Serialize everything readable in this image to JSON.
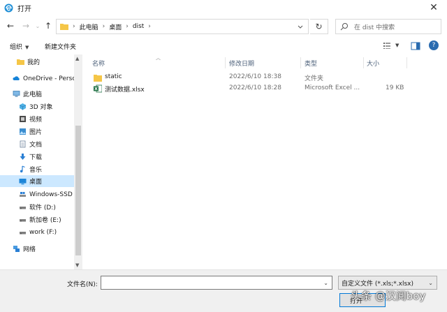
{
  "window": {
    "title": "打开"
  },
  "nav": {
    "breadcrumb": [
      "此电脑",
      "桌面",
      "dist"
    ]
  },
  "search": {
    "placeholder": "在 dist 中搜索"
  },
  "toolbar": {
    "organize_label": "组织",
    "new_folder_label": "新建文件夹"
  },
  "sidebar": {
    "items": [
      {
        "label": "我的",
        "icon": "folder-icon"
      },
      {
        "label": "OneDrive - Perso",
        "icon": "cloud-icon"
      },
      {
        "label": "此电脑",
        "icon": "computer-icon"
      },
      {
        "label": "3D 对象",
        "icon": "cube-icon"
      },
      {
        "label": "视频",
        "icon": "video-icon"
      },
      {
        "label": "图片",
        "icon": "picture-icon"
      },
      {
        "label": "文档",
        "icon": "document-icon"
      },
      {
        "label": "下载",
        "icon": "download-icon"
      },
      {
        "label": "音乐",
        "icon": "music-icon"
      },
      {
        "label": "桌面",
        "icon": "desktop-icon"
      },
      {
        "label": "Windows-SSD",
        "icon": "drive-icon"
      },
      {
        "label": "软件 (D:)",
        "icon": "drive-icon"
      },
      {
        "label": "新加卷 (E:)",
        "icon": "drive-icon"
      },
      {
        "label": "work (F:)",
        "icon": "drive-icon"
      },
      {
        "label": "网络",
        "icon": "network-icon"
      }
    ]
  },
  "columns": {
    "name": "名称",
    "modified": "修改日期",
    "type": "类型",
    "size": "大小"
  },
  "files": [
    {
      "name": "static",
      "modified": "2022/6/10 18:38",
      "type": "文件夹",
      "size": "",
      "icon": "folder-icon"
    },
    {
      "name": "测试数据.xlsx",
      "modified": "2022/6/10 18:28",
      "type": "Microsoft Excel ...",
      "size": "19 KB",
      "icon": "excel-icon"
    }
  ],
  "bottom": {
    "filename_label": "文件名(N):",
    "filename_value": "",
    "filetype_value": "自定义文件 (*.xls;*.xlsx)",
    "open_label": "打开"
  },
  "watermark": "头条 @汉阅boy",
  "colors": {
    "accent": "#0078d7",
    "selected": "#cce8ff",
    "folder": "#f5c647",
    "excel": "#1d6f42"
  }
}
